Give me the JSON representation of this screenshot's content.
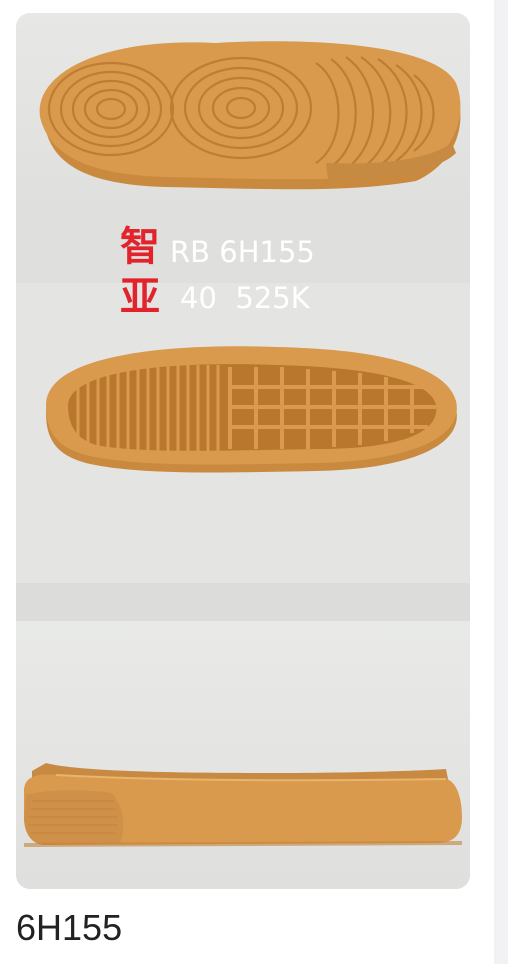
{
  "listing": {
    "overlay": {
      "brand_char_1": "智",
      "brand_char_2": "亚",
      "line_1": "RB 6H155",
      "line_2": "40  525K"
    },
    "caption": "6H155"
  },
  "colors": {
    "sole_rubber": "#d99a4e",
    "brand_red": "#e2232b",
    "background_gray": "#e3e4e2"
  }
}
